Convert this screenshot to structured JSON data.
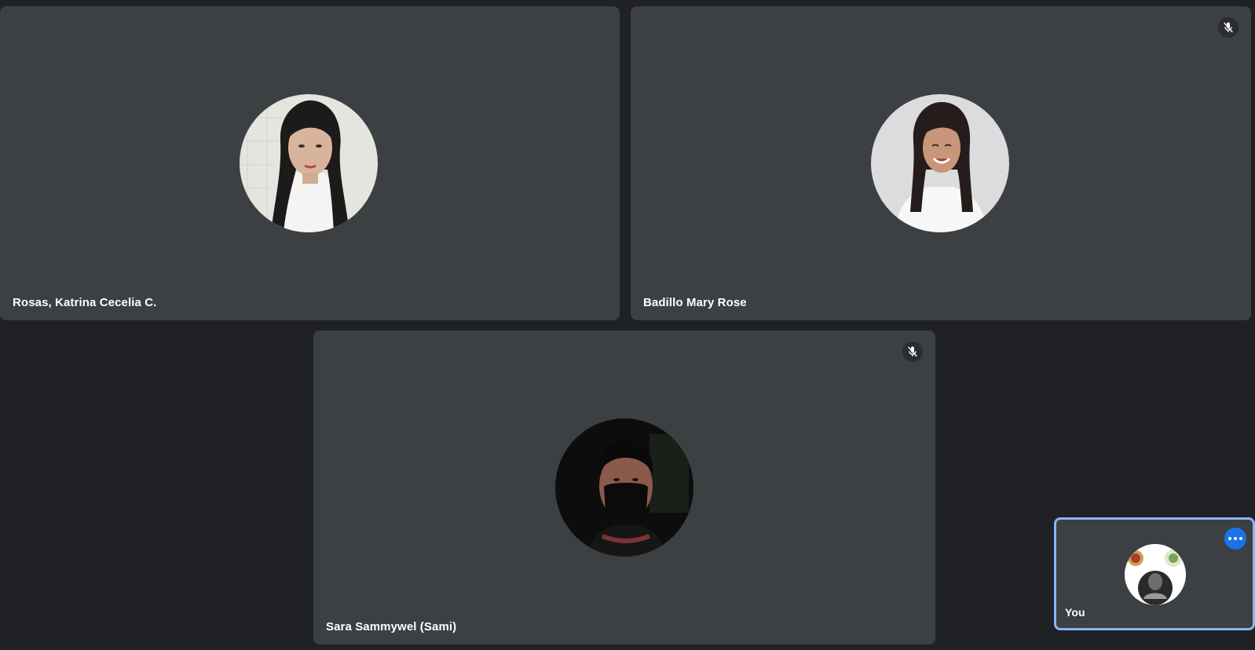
{
  "participants": [
    {
      "name": "Rosas, Katrina Cecelia C.",
      "muted": false
    },
    {
      "name": "Badillo Mary Rose",
      "muted": true
    },
    {
      "name": "Sara Sammywel (Sami)",
      "muted": true
    }
  ],
  "self_view": {
    "name": "You"
  },
  "icons": {
    "mic_off": "mic-off-icon",
    "more_options": "more-options-icon"
  },
  "colors": {
    "background": "#202124",
    "tile": "#3c4043",
    "self_border": "#8ab4f8",
    "accent": "#1a73e8",
    "text": "#ffffff"
  }
}
